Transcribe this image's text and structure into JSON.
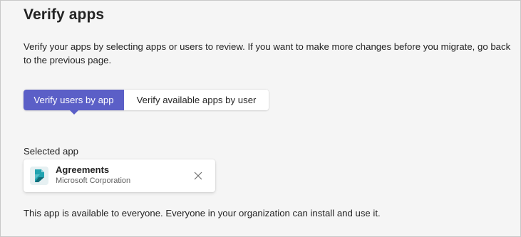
{
  "page": {
    "title": "Verify apps",
    "description": "Verify your apps by selecting apps or users to review. If you want to make more changes before you migrate, go back to the previous page."
  },
  "tabs": [
    {
      "label": "Verify users by app",
      "active": true
    },
    {
      "label": "Verify available apps by user",
      "active": false
    }
  ],
  "selected_app": {
    "section_label": "Selected app",
    "name": "Agreements",
    "publisher": "Microsoft Corporation",
    "icon": "agreements-app-icon",
    "remove_icon": "close-icon"
  },
  "availability_text": "This app is available to everyone. Everyone in your organization can install and use it.",
  "colors": {
    "accent": "#5b5fc7",
    "background": "#f5f5f5",
    "card": "#ffffff",
    "app_icon_teal": "#1b9aa8"
  }
}
